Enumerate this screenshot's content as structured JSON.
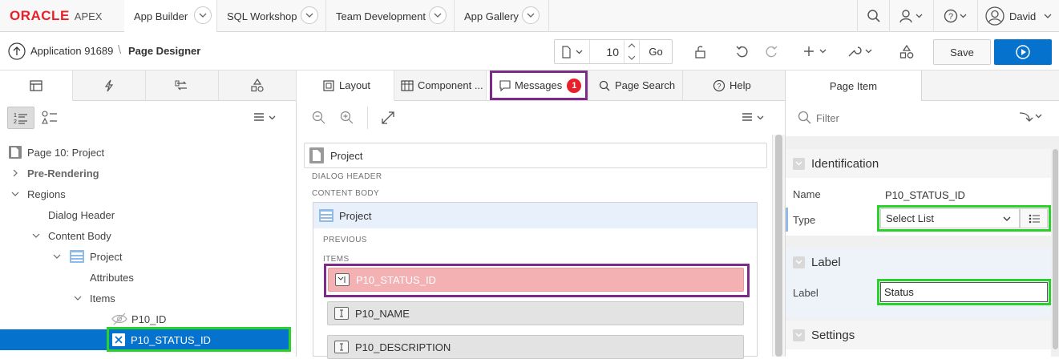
{
  "nav": {
    "logo_brand": "ORACLE",
    "logo_product": "APEX",
    "tabs": [
      "App Builder",
      "SQL Workshop",
      "Team Development",
      "App Gallery"
    ],
    "user": "David"
  },
  "toolbar": {
    "breadcrumb_app": "Application 91689",
    "breadcrumb_page": "Page Designer",
    "page_number": "10",
    "go_label": "Go",
    "save_label": "Save"
  },
  "left": {
    "tree": {
      "root": "Page 10: Project",
      "pre_rendering": "Pre-Rendering",
      "regions": "Regions",
      "dialog_header": "Dialog Header",
      "content_body": "Content Body",
      "project": "Project",
      "attributes": "Attributes",
      "items": "Items",
      "p10_id": "P10_ID",
      "p10_status_id": "P10_STATUS_ID"
    }
  },
  "center": {
    "tabs": [
      "Layout",
      "Component ...",
      "Messages",
      "Page Search",
      "Help"
    ],
    "messages_count": "1",
    "region_title": "Project",
    "dialog_header": "DIALOG HEADER",
    "content_body": "CONTENT BODY",
    "project_region": "Project",
    "previous": "PREVIOUS",
    "items_label": "ITEMS",
    "items": [
      "P10_STATUS_ID",
      "P10_NAME",
      "P10_DESCRIPTION"
    ]
  },
  "right": {
    "tab": "Page Item",
    "filter_placeholder": "Filter",
    "identification": "Identification",
    "name_label": "Name",
    "name_value": "P10_STATUS_ID",
    "type_label": "Type",
    "type_value": "Select List",
    "label_section": "Label",
    "label_label": "Label",
    "label_value": "Status",
    "settings": "Settings"
  },
  "colors": {
    "accent": "#0572ce",
    "error_item": "#f4b1b4",
    "highlight_green": "#2ad12a",
    "highlight_purple": "#7d2a8a",
    "badge_red": "#e8202a"
  }
}
